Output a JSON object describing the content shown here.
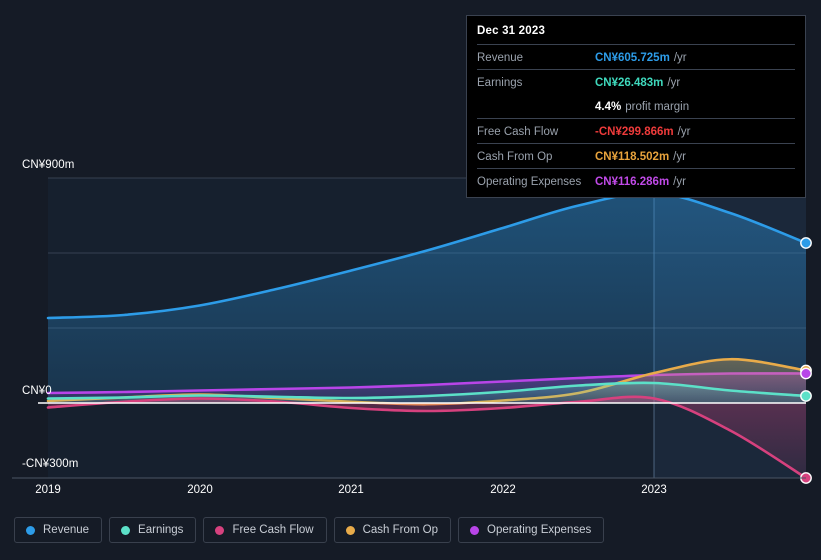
{
  "background": "#151b26",
  "axes": {
    "y_top_label": "CN¥900m",
    "y_zero_label": "CN¥0",
    "y_bottom_label": "-CN¥300m",
    "x_labels": [
      "2019",
      "2020",
      "2021",
      "2022",
      "2023"
    ]
  },
  "tooltip": {
    "date": "Dec 31 2023",
    "rows": [
      {
        "label": "Revenue",
        "value": "CN¥605.725m",
        "suffix": "/yr",
        "color": "#2d9ce8"
      },
      {
        "label": "Earnings",
        "value": "CN¥26.483m",
        "suffix": "/yr",
        "color": "#3fd9bd"
      },
      {
        "label": "",
        "value": "4.4%",
        "suffix": "profit margin",
        "color": "#ffffff"
      },
      {
        "label": "Free Cash Flow",
        "value": "-CN¥299.866m",
        "suffix": "/yr",
        "color": "#ef3b3b"
      },
      {
        "label": "Cash From Op",
        "value": "CN¥118.502m",
        "suffix": "/yr",
        "color": "#e8a33c"
      },
      {
        "label": "Operating Expenses",
        "value": "CN¥116.286m",
        "suffix": "/yr",
        "color": "#c14ae8"
      }
    ]
  },
  "legend": {
    "items": [
      {
        "label": "Revenue",
        "color": "#2d9ce8"
      },
      {
        "label": "Earnings",
        "color": "#5ce0c8"
      },
      {
        "label": "Free Cash Flow",
        "color": "#d6417e"
      },
      {
        "label": "Cash From Op",
        "color": "#e8ab4a"
      },
      {
        "label": "Operating Expenses",
        "color": "#b845e8"
      }
    ]
  },
  "chart_data": {
    "type": "area",
    "title": "",
    "xlabel": "",
    "ylabel": "CN¥",
    "currency": "CN¥",
    "units": "millions",
    "ylim": [
      -300,
      900
    ],
    "xlim": [
      "2019",
      "2023.75"
    ],
    "grid": true,
    "gridlines_y": [
      900,
      600,
      300,
      0,
      -300
    ],
    "zero_line": 0,
    "cursor_x": "2023",
    "legend_position": "bottom-left",
    "x": [
      "2019",
      "2019.5",
      "2020",
      "2020.5",
      "2021",
      "2021.5",
      "2022",
      "2022.5",
      "2023",
      "2023.4",
      "2023.75"
    ],
    "series": [
      {
        "name": "Revenue",
        "color": "#2d9ce8",
        "values": [
          340,
          352,
          390,
          455,
          530,
          610,
          700,
          790,
          840,
          760,
          640
        ],
        "end_value": 605.725
      },
      {
        "name": "Earnings",
        "color": "#5ce0c8",
        "values": [
          18,
          22,
          30,
          25,
          20,
          28,
          45,
          70,
          80,
          50,
          28
        ],
        "end_value": 26.483
      },
      {
        "name": "Free Cash Flow",
        "color": "#d6417e",
        "values": [
          -18,
          5,
          18,
          6,
          -20,
          -32,
          -20,
          5,
          18,
          -110,
          -300
        ],
        "end_value": -299.866
      },
      {
        "name": "Cash From Op",
        "color": "#e8ab4a",
        "values": [
          8,
          22,
          34,
          20,
          5,
          -5,
          10,
          40,
          120,
          175,
          130
        ],
        "end_value": 118.502
      },
      {
        "name": "Operating Expenses",
        "color": "#b845e8",
        "values": [
          40,
          44,
          50,
          56,
          62,
          72,
          86,
          100,
          112,
          118,
          118
        ],
        "end_value": 116.286
      }
    ]
  }
}
